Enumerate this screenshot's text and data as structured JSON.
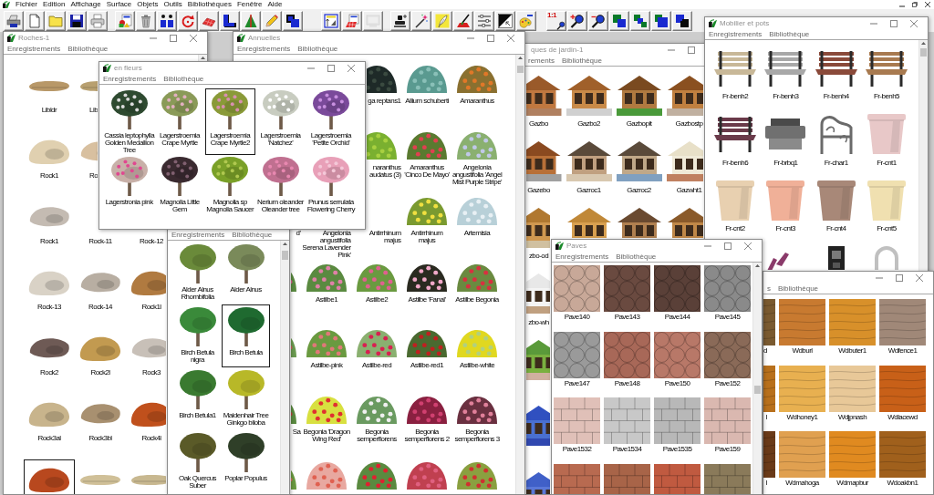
{
  "menus": [
    "Fichier",
    "Edition",
    "Affichage",
    "Surface",
    "Objets",
    "Outils",
    "Bibliothèques",
    "Fenêtre",
    "Aide"
  ],
  "toolbar": [
    {
      "buttons": [
        {
          "disabled": false
        },
        {
          "disabled": false
        },
        {
          "disabled": false
        },
        {
          "disabled": false
        },
        {
          "disabled": false
        }
      ]
    },
    {
      "buttons": [
        {
          "disabled": false
        },
        {
          "disabled": false
        },
        {
          "disabled": false
        },
        {
          "disabled": false
        },
        {
          "disabled": false
        },
        {
          "disabled": false
        },
        {
          "disabled": false
        },
        {
          "disabled": false
        },
        {
          "disabled": false
        }
      ]
    },
    {
      "buttons": [
        {
          "disabled": false
        },
        {
          "disabled": false
        },
        {
          "disabled": true
        }
      ]
    },
    {
      "buttons": [
        {
          "disabled": false
        },
        {
          "disabled": false
        },
        {
          "disabled": false
        },
        {
          "disabled": false
        },
        {
          "disabled": false
        },
        {
          "disabled": false
        },
        {
          "disabled": false
        }
      ]
    },
    {
      "buttons": [
        {
          "label": "1:1",
          "disabled": false
        },
        {
          "disabled": false
        },
        {
          "disabled": false
        },
        {
          "disabled": false
        },
        {
          "disabled": false
        },
        {
          "disabled": false
        },
        {
          "disabled": false
        }
      ]
    }
  ],
  "windows": [
    {
      "kind": "rock",
      "title": "Roches-1",
      "menu": [
        "Enregistrements",
        "Bibliothèque"
      ],
      "rows": [
        [
          {
            "label": "Libldr",
            "selected": false
          },
          {
            "label": "Lib",
            "selected": false
          }
        ],
        [
          {
            "label": "Rock1",
            "selected": false
          },
          {
            "label": "Ro",
            "selected": false
          }
        ],
        [
          {
            "label": "Rock1",
            "selected": false
          },
          {
            "label": "Rock-11",
            "selected": false
          },
          {
            "label": "Rock-12",
            "selected": false
          }
        ],
        [
          {
            "label": "Rock-13",
            "selected": false
          },
          {
            "label": "Rock-14",
            "selected": false
          },
          {
            "label": "Rock1l",
            "selected": false
          }
        ],
        [
          {
            "label": "Rock2",
            "selected": false
          },
          {
            "label": "Rock2l",
            "selected": false
          },
          {
            "label": "Rock3",
            "selected": false
          }
        ],
        [
          {
            "label": "Rock3al",
            "selected": false
          },
          {
            "label": "Rock3bl",
            "selected": false
          },
          {
            "label": "Rock4l",
            "selected": false
          }
        ],
        [
          {
            "selected": true
          },
          {
            "selected": false
          },
          {
            "selected": false
          }
        ]
      ]
    },
    {
      "kind": "flowering-tree",
      "title": "en fleurs",
      "menu": [
        "Enregistrements",
        "Bibliothèque"
      ],
      "rows": [
        [
          {
            "label": "Cassia leptophylla Golden Medallion Tree",
            "selected": false
          },
          {
            "label": "Lagerstroemia Crape Myrtle",
            "selected": false
          },
          {
            "label": "Lagerstroemia Crape Myrtle2",
            "selected": true
          },
          {
            "label": "Lagerstroemia 'Natchez'",
            "selected": false
          },
          {
            "label": "Lagerstroemia 'Petite Orchid'",
            "selected": false
          }
        ],
        [
          {
            "label": "Lagerstronia pink",
            "selected": false
          },
          {
            "label": "Magnolia Little Gem",
            "selected": false
          },
          {
            "label": "Magnolia sp Magnolia Saucer",
            "selected": false
          },
          {
            "label": "Nerium oleander Oleander tree",
            "selected": false
          },
          {
            "label": "Prunus serrulata Flowering Cherry",
            "selected": false
          }
        ]
      ]
    },
    {
      "kind": "shrub",
      "title": "Annuelles",
      "menu": [
        "Enregistrements",
        "Bibliothèque"
      ],
      "rows": [
        [
          {
            "label": "ga reptans1",
            "selected": false
          },
          {
            "label": "Allium schuberti",
            "selected": false
          },
          {
            "label": "Amaranthus",
            "selected": false
          }
        ],
        [
          {
            "label": "naranthus\naudatus (3)",
            "selected": false
          },
          {
            "label": "Amaranthus 'Cinco De Mayo'",
            "selected": false
          },
          {
            "label": "Angelonia angustifolia 'Angel Mist Purple Stripe'",
            "selected": false
          }
        ],
        [
          {
            "label": "d'",
            "selected": false
          },
          {
            "label": "Angelonia angustifolia 'Serena Lavender Pink'",
            "selected": false
          },
          {
            "label": "Antirrhinum majus",
            "selected": false
          },
          {
            "label": "Antirrhinum majus",
            "selected": false
          },
          {
            "label": "Artemisia",
            "selected": false
          }
        ],
        [
          {
            "selected": false
          },
          {
            "label": "Astilbe1",
            "selected": false
          },
          {
            "label": "Astilbe2",
            "selected": false
          },
          {
            "label": "Astilbe 'Fanal'",
            "selected": false
          },
          {
            "label": "Astilbe Begonia",
            "selected": false
          }
        ],
        [
          {
            "selected": false
          },
          {
            "label": "Astilbe-pink",
            "selected": false
          },
          {
            "label": "Astilbe-red",
            "selected": false
          },
          {
            "label": "Astilbe-red1",
            "selected": false
          },
          {
            "label": "Astilbe-white",
            "selected": false
          }
        ],
        [
          {
            "label": "Sa",
            "selected": false
          },
          {
            "label": "Begonia 'Dragon Wing Red'",
            "selected": false
          },
          {
            "label": "Begonia semperflorens",
            "selected": false
          },
          {
            "label": "Begonia semperflorens 2",
            "selected": false
          },
          {
            "label": "Begonia semperflorens 3",
            "selected": false
          }
        ],
        [
          {
            "selected": false
          },
          {
            "selected": false
          },
          {
            "selected": false
          },
          {
            "selected": false
          },
          {
            "selected": false
          }
        ]
      ]
    },
    {
      "kind": "tree",
      "menu": [
        "Enregistrements",
        "Bibliothèque"
      ],
      "rows": [
        [
          {
            "label": "Alder Alnus Rhombifolia",
            "selected": false
          },
          {
            "label": "Alder Alnus",
            "selected": false
          }
        ],
        [
          {
            "label": "Birch Betula nigra",
            "selected": false
          },
          {
            "label": "Birch Betula",
            "selected": true
          }
        ],
        [
          {
            "label": "Birch Betula1",
            "selected": false
          },
          {
            "label": "Maidenhair Tree Ginkgo biloba",
            "selected": false
          }
        ],
        [
          {
            "label": "Oak Quercus Suber",
            "selected": false
          },
          {
            "label": "Poplar Populus",
            "selected": false
          }
        ]
      ]
    },
    {
      "kind": "gazebo",
      "title": "ques de jardin-1",
      "menu": [
        "rements",
        "Bibliothèque"
      ],
      "rows": [
        [
          {
            "label": "Gazbo",
            "selected": false
          },
          {
            "label": "Gazbo2",
            "selected": false
          },
          {
            "label": "Gazbopit",
            "selected": false
          },
          {
            "label": "Gazbostp",
            "selected": false
          }
        ],
        [
          {
            "label": "Gazebo",
            "selected": false
          },
          {
            "label": "Gazroc1",
            "selected": false
          },
          {
            "label": "Gazroc2",
            "selected": false
          },
          {
            "label": "Gazwht1",
            "selected": false
          }
        ],
        [
          {
            "label": "zbo-od",
            "selected": false
          },
          {
            "selected": false
          },
          {
            "selected": false
          },
          {
            "selected": false
          }
        ],
        [
          {
            "label": "zbo-wh",
            "selected": false
          }
        ],
        [
          {
            "selected": false
          }
        ],
        [
          {
            "selected": false
          }
        ],
        [
          {
            "selected": false
          }
        ]
      ]
    },
    {
      "kind": "furniture",
      "title": "Mobilier et pots",
      "menu": [
        "Enregistrements",
        "Bibliothèque"
      ],
      "rows": [
        [
          {
            "kind": "bench",
            "label": "Fr-benh2",
            "selected": false
          },
          {
            "kind": "bench",
            "label": "Fr-benh3",
            "selected": false
          },
          {
            "kind": "bench",
            "label": "Fr-benh4",
            "selected": false
          },
          {
            "kind": "bench",
            "label": "Fr-benh5",
            "selected": false
          }
        ],
        [
          {
            "kind": "bench",
            "label": "Fr-benh6",
            "selected": false
          },
          {
            "kind": "grill",
            "label": "Fr-brbq1",
            "selected": false
          },
          {
            "kind": "chair",
            "label": "Fr-char1",
            "selected": false
          },
          {
            "kind": "planter",
            "label": "Fr-cnt1",
            "selected": false
          }
        ],
        [
          {
            "kind": "planter",
            "label": "Fr-cnt2",
            "selected": false
          },
          {
            "kind": "planter",
            "label": "Fr-cnt3",
            "selected": false
          },
          {
            "kind": "planter",
            "label": "Fr-cnt4",
            "selected": false
          },
          {
            "kind": "planter",
            "label": "Fr-cnt5",
            "selected": false
          }
        ],
        [
          {
            "kind": "lounger",
            "selected": false
          },
          {
            "kind": "kiosk",
            "selected": false
          },
          {
            "kind": "arch",
            "selected": false
          }
        ]
      ]
    },
    {
      "kind": "paving",
      "title": "Paves",
      "menu": [
        "Enregistrements",
        "Bibliothèque"
      ],
      "rows": [
        [
          {
            "label": "Pave140",
            "selected": false
          },
          {
            "label": "Pave143",
            "selected": false
          },
          {
            "label": "Pave144",
            "selected": false
          },
          {
            "label": "Pave145",
            "selected": false
          }
        ],
        [
          {
            "label": "Pave147",
            "selected": false
          },
          {
            "label": "Pave148",
            "selected": false
          },
          {
            "label": "Pave150",
            "selected": false
          },
          {
            "label": "Pave152",
            "selected": false
          }
        ],
        [
          {
            "label": "Pave1532",
            "selected": false
          },
          {
            "label": "Pave1534",
            "selected": false
          },
          {
            "label": "Pave1535",
            "selected": false
          },
          {
            "label": "Pave159",
            "selected": false
          }
        ],
        [
          {
            "selected": false
          },
          {
            "selected": false
          },
          {
            "selected": false
          },
          {
            "selected": false
          }
        ]
      ]
    },
    {
      "kind": "wood",
      "menu": [
        "s",
        "Bibliothèque"
      ],
      "rows": [
        [
          {
            "label": "d",
            "selected": false
          },
          {
            "label": "Wdburl",
            "selected": false
          },
          {
            "label": "Wdbuter1",
            "selected": false
          },
          {
            "label": "Wdfence1",
            "selected": false
          }
        ],
        [
          {
            "label": "l",
            "selected": false
          },
          {
            "label": "Wdhoney1",
            "selected": false
          },
          {
            "label": "Wdjpnash",
            "selected": false
          },
          {
            "label": "Wdlacewd",
            "selected": false
          }
        ],
        [
          {
            "label": "l",
            "selected": false
          },
          {
            "label": "Wdmahoga",
            "selected": false
          },
          {
            "label": "Wdmapbur",
            "selected": false
          },
          {
            "label": "Wdoakbn1",
            "selected": false
          }
        ]
      ]
    }
  ]
}
